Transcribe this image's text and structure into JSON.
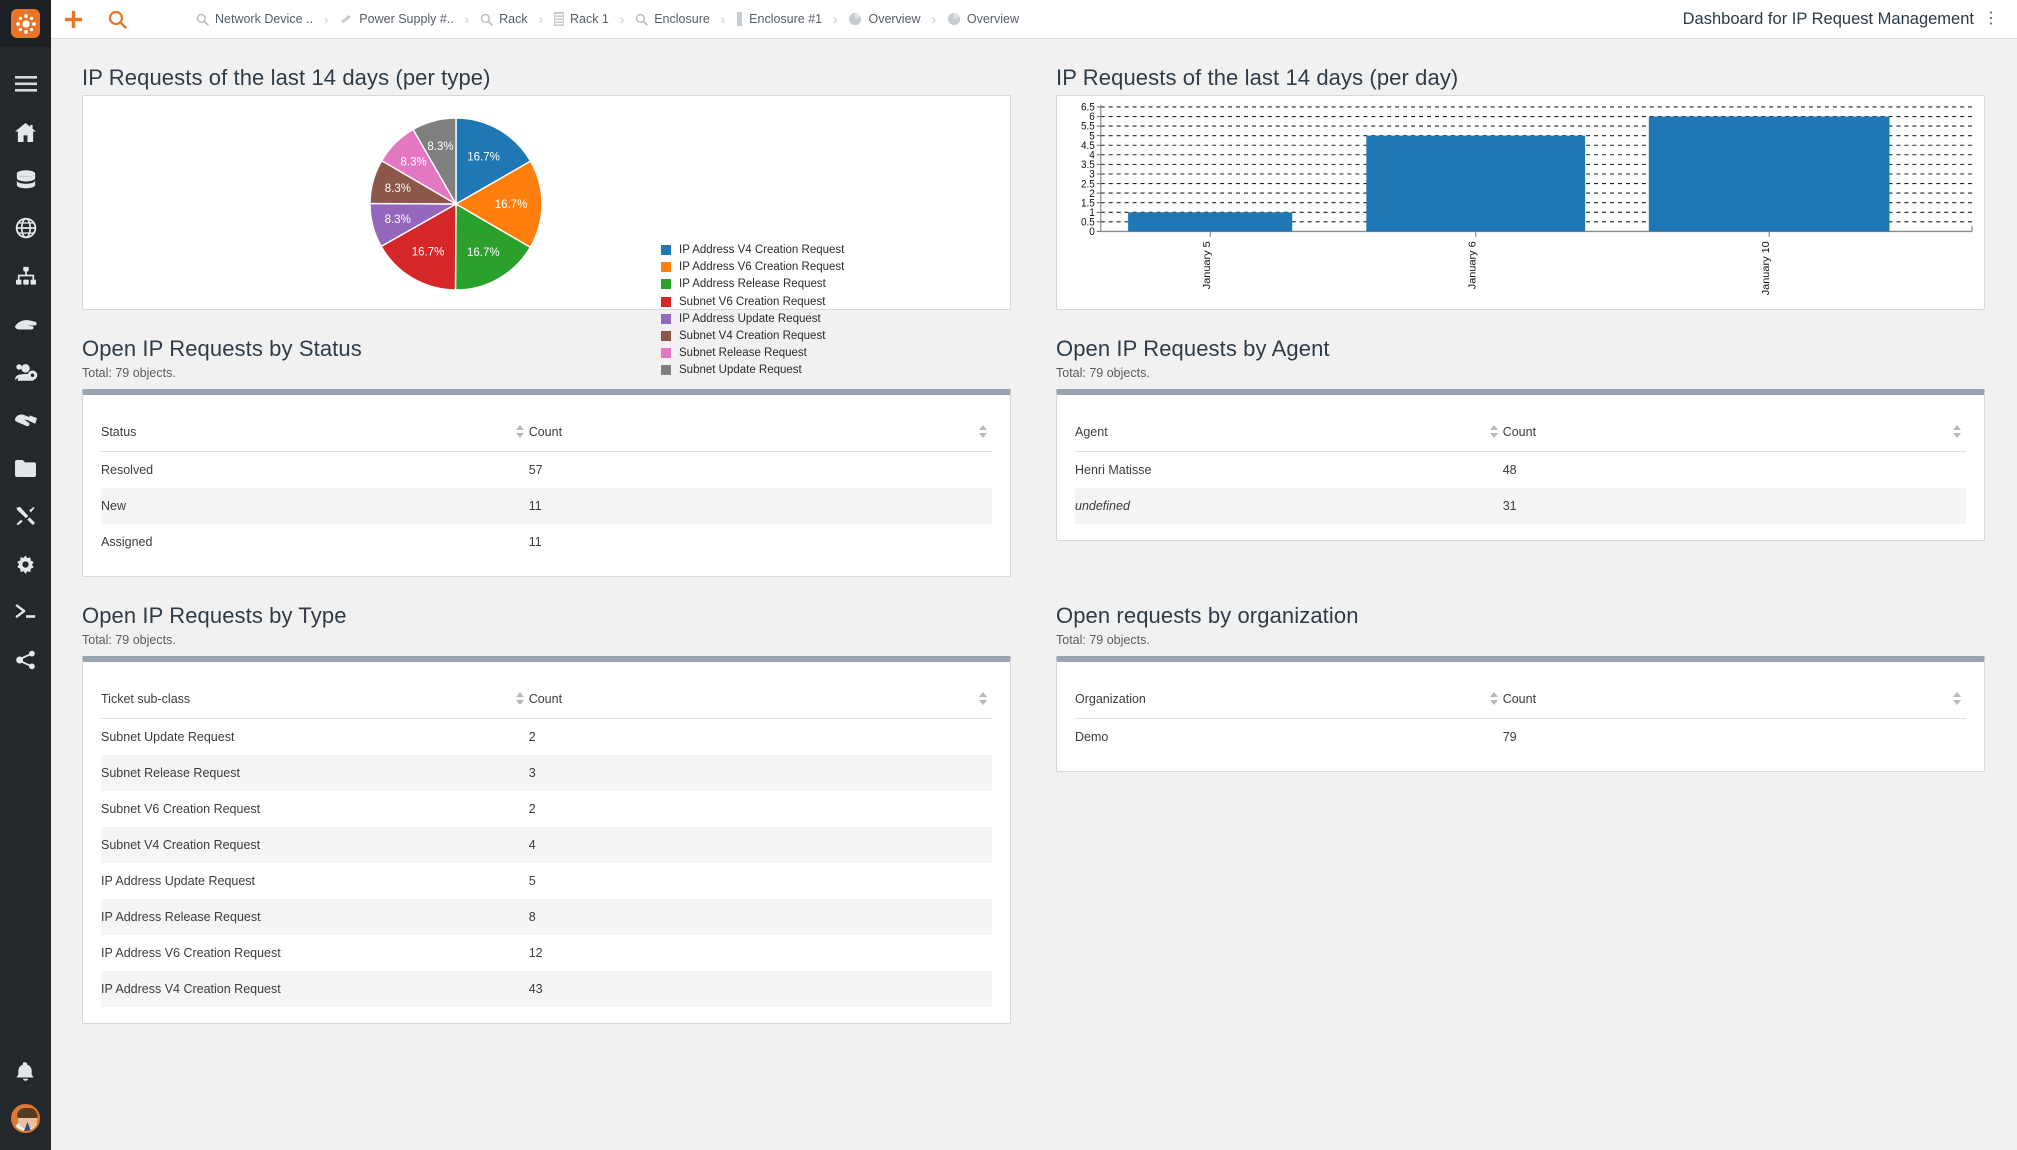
{
  "app": {
    "logo_name": "itop-logo",
    "accent": "#e8762a",
    "sidebar_bg": "#23282d"
  },
  "topbar": {
    "new_label": "+",
    "search_label": "search",
    "page_title": "Dashboard for IP Request Management",
    "menu_glyph": "⋮",
    "breadcrumb": [
      {
        "label": "Network Device ..",
        "icon": "magnifier-icon"
      },
      {
        "label": "Power Supply #..",
        "icon": "power-supply-icon"
      },
      {
        "label": "Rack",
        "icon": "magnifier-icon"
      },
      {
        "label": "Rack 1",
        "icon": "rack-icon"
      },
      {
        "label": "Enclosure",
        "icon": "magnifier-icon"
      },
      {
        "label": "Enclosure #1",
        "icon": "enclosure-icon"
      },
      {
        "label": "Overview",
        "icon": "pie-chart-icon"
      },
      {
        "label": "Overview",
        "icon": "pie-chart-icon"
      }
    ],
    "separator": "›"
  },
  "sidebar": {
    "items": [
      {
        "name": "menu-toggle",
        "icon": "hamburger-icon"
      },
      {
        "name": "welcome",
        "icon": "home-icon"
      },
      {
        "name": "data-administration",
        "icon": "database-icon"
      },
      {
        "name": "network",
        "icon": "globe-icon"
      },
      {
        "name": "configuration",
        "icon": "sitemap-icon"
      },
      {
        "name": "service-management",
        "icon": "hand-icon"
      },
      {
        "name": "user-management",
        "icon": "users-cog-icon"
      },
      {
        "name": "service-delivery",
        "icon": "handshake-icon"
      },
      {
        "name": "documents",
        "icon": "folder-icon"
      },
      {
        "name": "change-management",
        "icon": "tools-icon"
      },
      {
        "name": "admin-tools",
        "icon": "gear-icon"
      },
      {
        "name": "console",
        "icon": "terminal-icon"
      },
      {
        "name": "share",
        "icon": "share-icon"
      }
    ],
    "bottom": [
      {
        "name": "notifications",
        "icon": "bell-icon"
      },
      {
        "name": "user-avatar",
        "icon": "avatar-icon"
      }
    ]
  },
  "blocks": {
    "pie": {
      "title": "IP Requests of the last 14 days (per type)"
    },
    "bar": {
      "title": "IP Requests of the last 14 days (per day)"
    },
    "status": {
      "title": "Open IP Requests by Status",
      "subtitle": "Total: 79 objects.",
      "columns": [
        "Status",
        "Count"
      ],
      "rows": [
        {
          "label": "Resolved",
          "count": "57"
        },
        {
          "label": "New",
          "count": "11"
        },
        {
          "label": "Assigned",
          "count": "11"
        }
      ]
    },
    "agent": {
      "title": "Open IP Requests by Agent",
      "subtitle": "Total: 79 objects.",
      "columns": [
        "Agent",
        "Count"
      ],
      "rows": [
        {
          "label": "Henri Matisse",
          "count": "48",
          "style": "link"
        },
        {
          "label": "undefined",
          "count": "31",
          "style": "italic"
        }
      ]
    },
    "type": {
      "title": "Open IP Requests by Type",
      "subtitle": "Total: 79 objects.",
      "columns": [
        "Ticket sub-class",
        "Count"
      ],
      "rows": [
        {
          "label": "Subnet Update Request",
          "count": "2"
        },
        {
          "label": "Subnet Release Request",
          "count": "3"
        },
        {
          "label": "Subnet V6 Creation Request",
          "count": "2"
        },
        {
          "label": "Subnet V4 Creation Request",
          "count": "4"
        },
        {
          "label": "IP Address Update Request",
          "count": "5"
        },
        {
          "label": "IP Address Release Request",
          "count": "8"
        },
        {
          "label": "IP Address V6 Creation Request",
          "count": "12"
        },
        {
          "label": "IP Address V4 Creation Request",
          "count": "43"
        }
      ]
    },
    "organization": {
      "title": "Open requests by organization",
      "subtitle": "Total: 79 objects.",
      "columns": [
        "Organization",
        "Count"
      ],
      "rows": [
        {
          "label": "Demo",
          "count": "79",
          "style": "link"
        }
      ]
    }
  },
  "chart_data": [
    {
      "type": "pie",
      "title": "IP Requests of the last 14 days (per type)",
      "legend_position": "right",
      "labels": [
        "IP Address V4 Creation Request",
        "IP Address V6 Creation Request",
        "IP Address Release Request",
        "Subnet V6 Creation Request",
        "IP Address Update Request",
        "Subnet V4 Creation Request",
        "Subnet Release Request",
        "Subnet Update Request"
      ],
      "values": [
        16.7,
        16.7,
        16.7,
        16.7,
        8.3,
        8.3,
        8.3,
        8.3
      ],
      "value_labels": [
        "16.7%",
        "16.7%",
        "16.7%",
        "16.7%",
        "8.3%",
        "8.3%",
        "8.3%",
        "8.3%"
      ],
      "colors": [
        "#1f77b4",
        "#ff7f0e",
        "#2ca02c",
        "#d62728",
        "#9467bd",
        "#8c564b",
        "#e377c2",
        "#7f7f7f"
      ]
    },
    {
      "type": "bar",
      "title": "IP Requests of the last 14 days (per day)",
      "categories": [
        "January 5",
        "January 6",
        "January 10"
      ],
      "values": [
        1,
        5,
        6
      ],
      "xlabel": "",
      "ylabel": "",
      "ylim": [
        0,
        6.5
      ],
      "ytick_labels": [
        "0",
        "0.5",
        "1",
        "1.5",
        "2",
        "2.5",
        "3",
        "3.5",
        "4",
        "4.5",
        "5",
        "5.5",
        "6",
        "6.5"
      ],
      "grid": true,
      "bar_color": "#1f77b4"
    }
  ]
}
